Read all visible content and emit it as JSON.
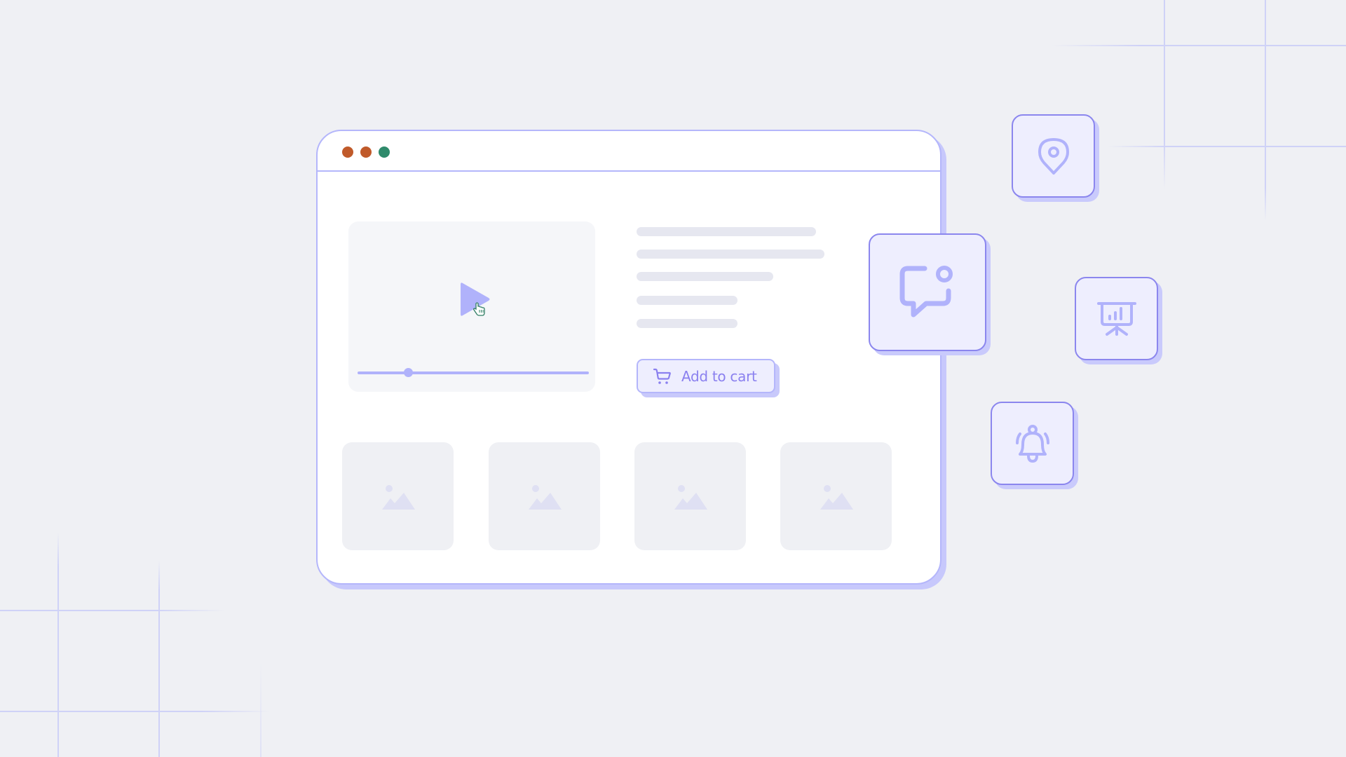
{
  "window": {
    "controls": [
      {
        "name": "close",
        "color": "#c05a2a"
      },
      {
        "name": "minimize",
        "color": "#c05a2a"
      },
      {
        "name": "maximize",
        "color": "#2f8a6b"
      }
    ]
  },
  "video": {
    "play_icon": "play-icon",
    "progress_fraction": 0.22
  },
  "product": {
    "text_placeholder_lines": 5,
    "add_to_cart_label": "Add to cart",
    "cart_icon": "shopping-cart-icon"
  },
  "gallery": {
    "thumbnails": [
      {
        "icon": "image-placeholder-icon"
      },
      {
        "icon": "image-placeholder-icon"
      },
      {
        "icon": "image-placeholder-icon"
      },
      {
        "icon": "image-placeholder-icon"
      }
    ]
  },
  "floating_icons": [
    {
      "name": "location-pin-icon"
    },
    {
      "name": "chat-notification-icon"
    },
    {
      "name": "presentation-chart-icon"
    },
    {
      "name": "bell-ringing-icon"
    }
  ],
  "colors": {
    "background": "#eff0f4",
    "accent": "#b0b2fb",
    "accent_text": "#8a80ef",
    "card_fill": "#eeeefe",
    "placeholder": "#e6e7f0"
  }
}
